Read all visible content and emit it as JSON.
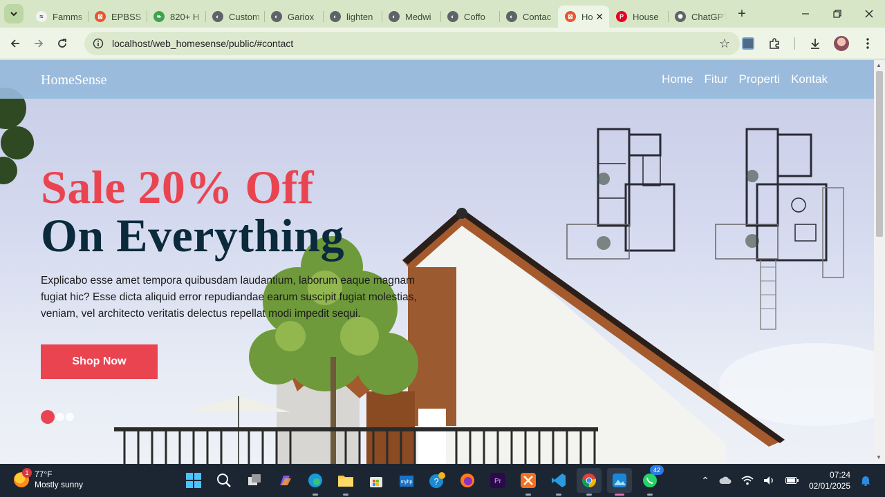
{
  "browser": {
    "tabs": [
      {
        "title": "Famms",
        "favicon_color": "#f3f3f3",
        "favicon_glyph": "≈"
      },
      {
        "title": "EPBSS",
        "favicon_color": "#e8552f",
        "favicon_glyph": "⊠"
      },
      {
        "title": "820+ H",
        "favicon_color": "#3fa34d",
        "favicon_glyph": "❧"
      },
      {
        "title": "Custom",
        "favicon_color": "#5f6368",
        "favicon_glyph": "◐"
      },
      {
        "title": "Gariox",
        "favicon_color": "#5f6368",
        "favicon_glyph": "◐"
      },
      {
        "title": "lighten",
        "favicon_color": "#5f6368",
        "favicon_glyph": "◐"
      },
      {
        "title": "Medwi",
        "favicon_color": "#5f6368",
        "favicon_glyph": "◐"
      },
      {
        "title": "Coffo",
        "favicon_color": "#5f6368",
        "favicon_glyph": "◐"
      },
      {
        "title": "Contac",
        "favicon_color": "#5f6368",
        "favicon_glyph": "◐"
      },
      {
        "title": "Ho",
        "favicon_color": "#e8552f",
        "favicon_glyph": "⊠",
        "active": true
      },
      {
        "title": "House",
        "favicon_color": "#e60023",
        "favicon_glyph": "P"
      },
      {
        "title": "ChatGPT",
        "favicon_color": "#5f6368",
        "favicon_glyph": "✺"
      }
    ],
    "url": "localhost/web_homesense/public/#contact",
    "new_tab_glyph": "+",
    "close_tab_glyph": "✕"
  },
  "site": {
    "brand": "HomeSense",
    "nav": [
      "Home",
      "Fitur",
      "Properti",
      "Kontak"
    ],
    "hero": {
      "headline_sale": "Sale 20% Off",
      "headline_main": "On Everything",
      "description": "Explicabo esse amet tempora quibusdam laudantium, laborum eaque magnam fugiat hic? Esse dicta aliquid error repudiandae earum suscipit fugiat molestias, veniam, vel architecto veritatis delectus repellat modi impedit sequi.",
      "cta": "Shop Now",
      "slides": 3,
      "active_slide": 1
    },
    "colors": {
      "accent": "#ea4451",
      "dark": "#0b2a3c",
      "navbar": "#96badb"
    }
  },
  "taskbar": {
    "weather_temp": "77°F",
    "weather_desc": "Mostly sunny",
    "weather_badge": "1",
    "whatsapp_badge": "42",
    "time": "07:24",
    "date": "02/01/2025",
    "apps": [
      "start-icon",
      "search-icon",
      "task-view-icon",
      "copilot-icon",
      "edge-icon",
      "file-explorer-icon",
      "store-icon",
      "myhp-icon",
      "help-icon",
      "firefox-icon",
      "premiere-icon",
      "xampp-icon",
      "vscode-icon",
      "chrome-icon",
      "photos-icon",
      "whatsapp-icon"
    ]
  }
}
